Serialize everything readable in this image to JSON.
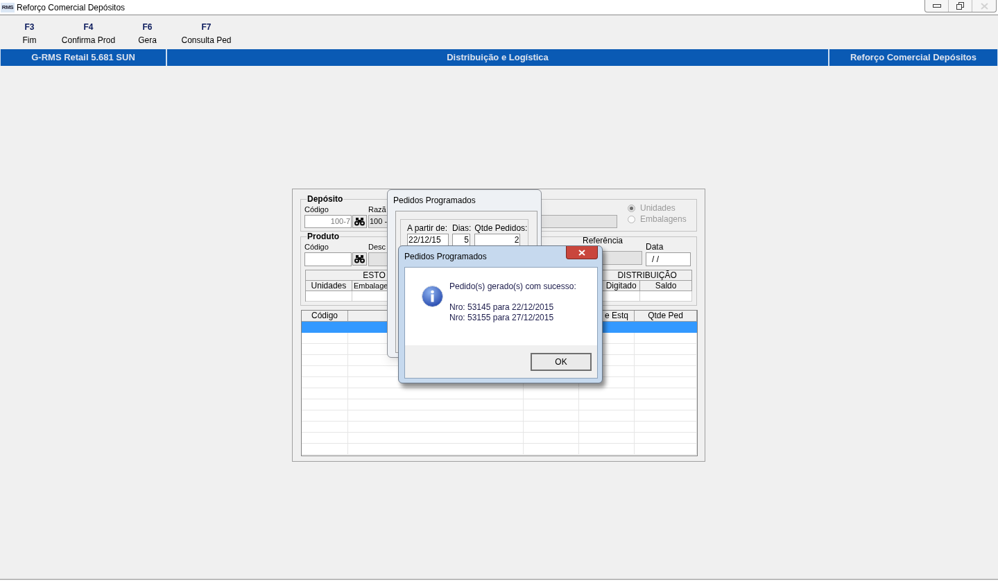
{
  "window": {
    "title": "Reforço Comercial Depósitos",
    "icon_text": "RMS",
    "controls": [
      {
        "kind": "minimize",
        "disabled": false
      },
      {
        "kind": "restore",
        "disabled": false
      },
      {
        "kind": "close",
        "disabled": true
      }
    ]
  },
  "toolbar": [
    {
      "key": "F3",
      "label": "Fim"
    },
    {
      "key": "F4",
      "label": "Confirma Prod"
    },
    {
      "key": "F6",
      "label": "Gera"
    },
    {
      "key": "F7",
      "label": "Consulta Ped"
    }
  ],
  "header_bar": [
    "G-RMS Retail 5.681 SUN",
    "Distribuição e Logística",
    "Reforço Comercial Depósitos"
  ],
  "form": {
    "deposito": {
      "title": "Depósito",
      "codigo_label": "Código",
      "codigo_value": "100-7",
      "razao_label": "Razã",
      "razao_value": "100 -",
      "unit_options": [
        {
          "label": "Unidades",
          "selected": true,
          "disabled": true
        },
        {
          "label": "Embalagens",
          "selected": false,
          "disabled": true
        }
      ]
    },
    "produto": {
      "title": "Produto",
      "codigo_label": "Código",
      "descricao_label": "Desc",
      "referencia_label": "Referência",
      "data_label": "Data",
      "data_value": "/ /",
      "estoque_heading": "ESTO",
      "distribuicao_heading": "DISTRIBUIÇÃO",
      "columns": [
        "Unidades",
        "Embalage",
        "Digitado",
        "Saldo"
      ]
    },
    "grid": {
      "columns": [
        "Código",
        "e Estq",
        "Qtde Ped"
      ],
      "rows": [
        {
          "selected": true
        },
        {
          "selected": false
        },
        {
          "selected": false
        },
        {
          "selected": false
        },
        {
          "selected": false
        },
        {
          "selected": false
        },
        {
          "selected": false
        },
        {
          "selected": false
        },
        {
          "selected": false
        },
        {
          "selected": false
        },
        {
          "selected": false
        },
        {
          "selected": false
        }
      ]
    }
  },
  "schedule_dialog": {
    "title": "Pedidos Programados",
    "fields": [
      {
        "label": "A partir de:",
        "value": "22/12/15"
      },
      {
        "label": "Dias:",
        "value": "5"
      },
      {
        "label": "Qtde Pedidos:",
        "value": "2"
      }
    ]
  },
  "message_dialog": {
    "title": "Pedidos Programados",
    "message": "Pedido(s) gerado(s) com sucesso:",
    "lines": [
      "Nro: 53145 para 22/12/2015",
      "Nro: 53155 para 27/12/2015"
    ],
    "button": "OK"
  }
}
